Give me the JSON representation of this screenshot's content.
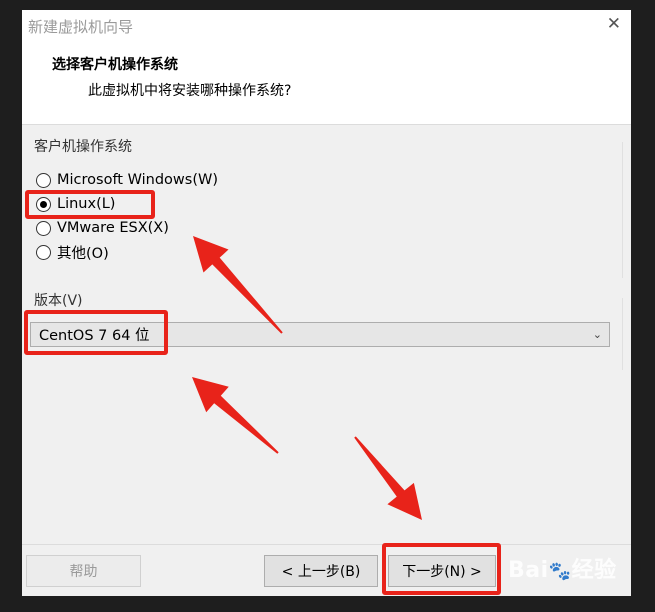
{
  "window": {
    "title": "新建虚拟机向导",
    "close_glyph": "✕"
  },
  "header": {
    "heading": "选择客户机操作系统",
    "subheading": "此虚拟机中将安装哪种操作系统?"
  },
  "os_group": {
    "label": "客户机操作系统",
    "options": [
      {
        "label": "Microsoft Windows(W)",
        "selected": false
      },
      {
        "label": "Linux(L)",
        "selected": true
      },
      {
        "label": "VMware ESX(X)",
        "selected": false
      },
      {
        "label": "其他(O)",
        "selected": false
      }
    ]
  },
  "version": {
    "label": "版本(V)",
    "value": "CentOS 7 64 位",
    "chevron": "⌄"
  },
  "buttons": {
    "help": "帮助",
    "back": "< 上一步(B)",
    "next": "下一步(N) >"
  },
  "annotation_color": "#e8231a",
  "watermark": {
    "text": "Bai",
    "paw": "🐾",
    "text2": "经验"
  }
}
